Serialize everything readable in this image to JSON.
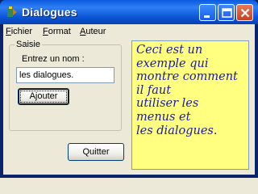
{
  "window": {
    "title": "Dialogues",
    "controls": [
      "minimize-icon",
      "maximize-icon",
      "close-icon"
    ]
  },
  "menubar": {
    "items": [
      {
        "label_first": "F",
        "label_rest": "ichier"
      },
      {
        "label_first": "F",
        "label_rest": "ormat"
      },
      {
        "label_first": "A",
        "label_rest": "uteur"
      }
    ]
  },
  "saisie": {
    "group_title": "Saisie",
    "prompt_label": "Entrez un nom :",
    "input_value": "les dialogues.",
    "add_button_label": "Ajouter"
  },
  "quit_button_label": "Quitter",
  "memo": {
    "lines": [
      "Ceci est un",
      "exemple qui",
      "montre comment",
      "il faut",
      "utiliser les",
      "menus et",
      "les dialogues."
    ],
    "background_color": "#ffff80",
    "text_color": "#1a1aa8"
  }
}
